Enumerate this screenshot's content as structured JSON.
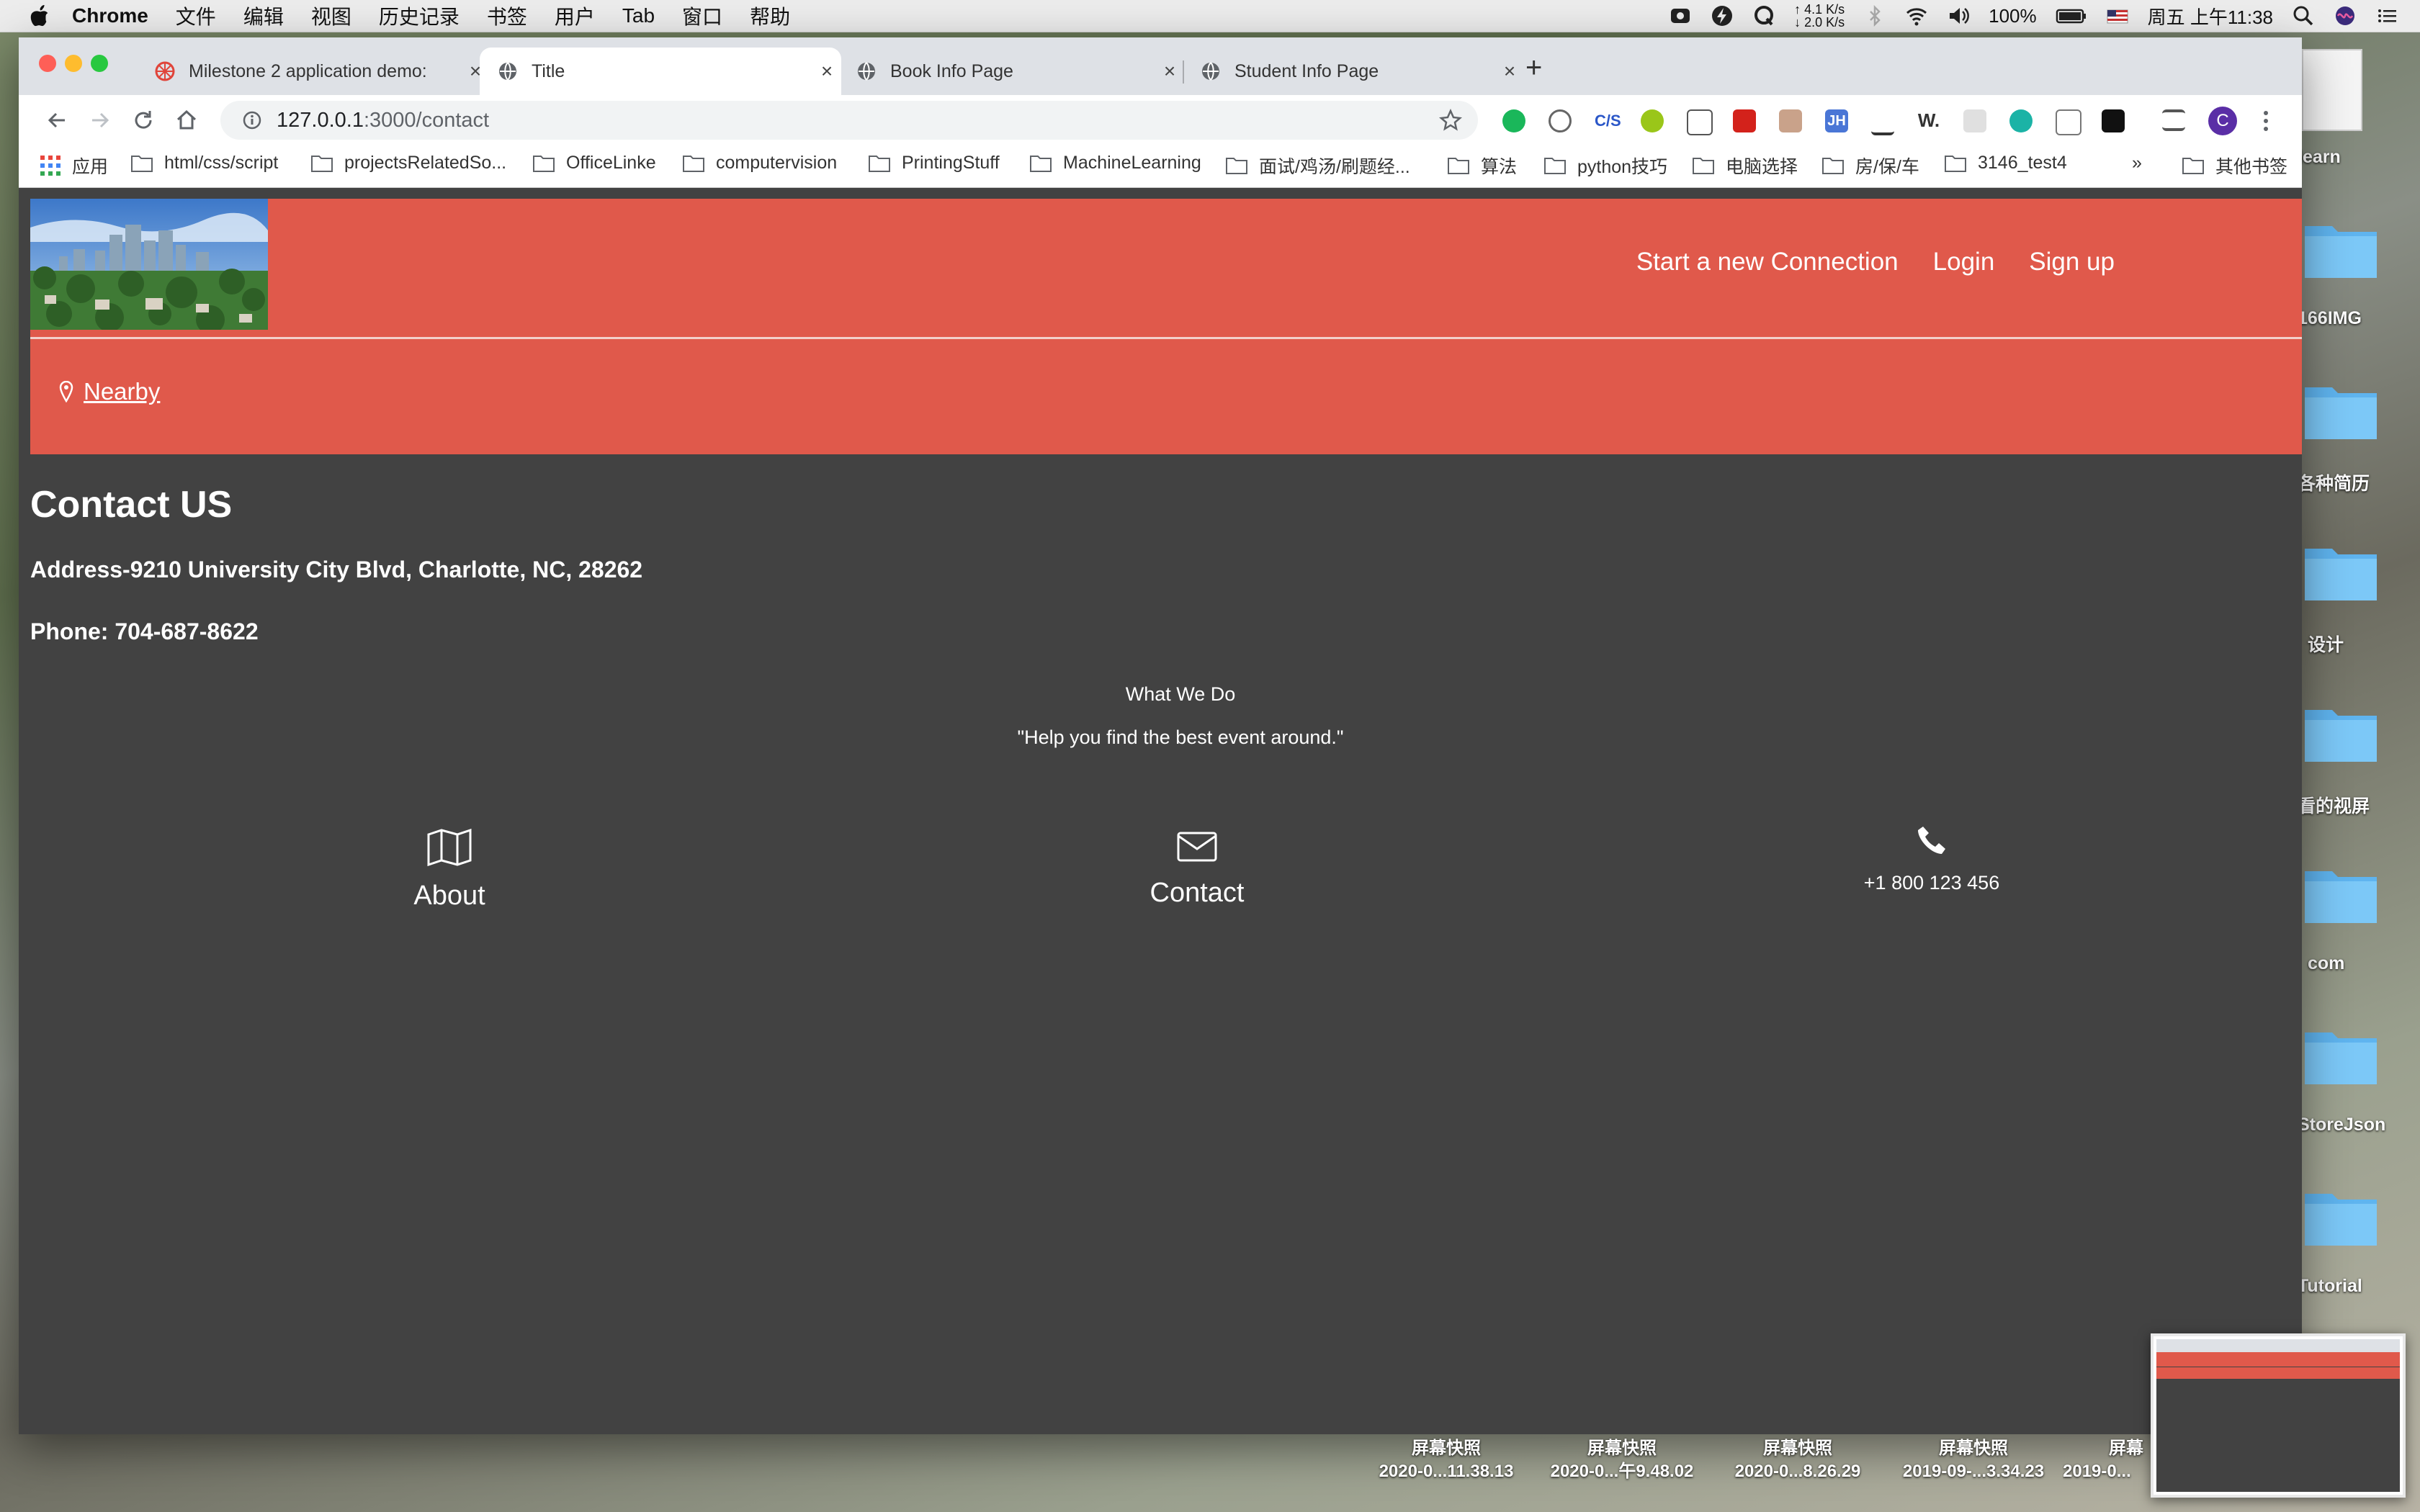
{
  "menubar": {
    "app": "Chrome",
    "menus": [
      "文件",
      "编辑",
      "视图",
      "历史记录",
      "书签",
      "用户",
      "Tab",
      "窗口",
      "帮助"
    ],
    "net_up": "↑ 4.1 K/s",
    "net_down": "↓ 2.0 K/s",
    "battery": "100%",
    "clock": "周五 上午11:38"
  },
  "tabs": [
    {
      "title": "Milestone 2 application demo:",
      "active": false
    },
    {
      "title": "Title",
      "active": true
    },
    {
      "title": "Book Info Page",
      "active": false
    },
    {
      "title": "Student Info Page",
      "active": false
    }
  ],
  "url": {
    "host": "127.0.0.1",
    "path": ":3000/contact"
  },
  "profile_initial": "C",
  "bookmarks": [
    "应用",
    "html/css/script",
    "projectsRelatedSo...",
    "OfficeLinke",
    "computervision",
    "PrintingStuff",
    "MachineLearning",
    "面试/鸡汤/刷题经...",
    "算法",
    "python技巧",
    "电脑选择",
    "房/保/车",
    "3146_test4",
    "»",
    "其他书签"
  ],
  "site": {
    "nav": [
      "Start a new Connection",
      "Login",
      "Sign up"
    ],
    "nearby": "Nearby",
    "contact_heading": "Contact US",
    "address": "Address-9210 University City Blvd, Charlotte, NC, 28262",
    "phone": "Phone: 704-687-8622",
    "what_we_do": "What We Do",
    "quote": "\"Help you find the best event around.\"",
    "columns": [
      {
        "icon": "map-icon",
        "label": "About"
      },
      {
        "icon": "envelope-icon",
        "label": "Contact"
      },
      {
        "icon": "phone-icon",
        "label": "+1 800 123 456"
      }
    ]
  },
  "desktop": {
    "labels": [
      "learn",
      "166IMG",
      "各种简历",
      "设计",
      "看的视屏",
      "com",
      "StoreJson",
      "Tutorial"
    ],
    "screenshots": [
      {
        "title": "屏幕快照",
        "name": "2020-0...11.38.13"
      },
      {
        "title": "屏幕快照",
        "name": "2020-0...午9.48.02"
      },
      {
        "title": "屏幕快照",
        "name": "2020-0...8.26.29"
      },
      {
        "title": "屏幕快照",
        "name": "2019-09-...3.34.23"
      },
      {
        "title": "屏幕",
        "name": "2019-0..."
      }
    ]
  },
  "colors": {
    "header": "#e0594b",
    "page_bg": "#424242"
  }
}
